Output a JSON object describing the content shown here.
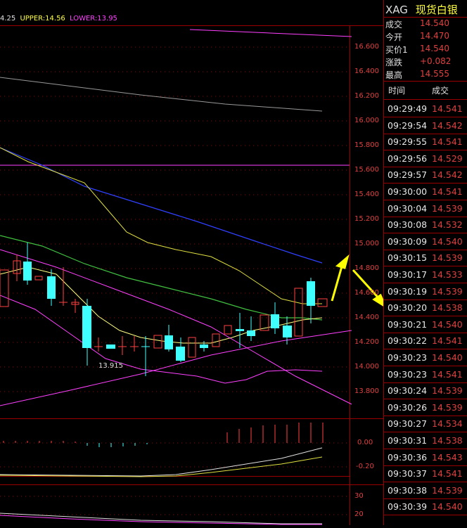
{
  "indicator_legend": {
    "mid": "4.25",
    "upper": "UPPER:14.56",
    "lower": "LOWER:13.95"
  },
  "colors": {
    "up_candle": "#ff4040",
    "down_candle": "#40ffff",
    "grid": "#9a0000",
    "price_text": "#e04040",
    "upper_legend": "#ffff40",
    "lower_legend": "#ff40ff",
    "arrow": "#ffff00"
  },
  "price_axis": [
    "16.600",
    "16.400",
    "16.200",
    "16.000",
    "15.800",
    "15.600",
    "15.400",
    "15.200",
    "15.000",
    "14.800",
    "14.600",
    "14.400",
    "14.200",
    "14.000",
    "13.800"
  ],
  "macd_axis": [
    "0.00",
    "-0.20"
  ],
  "rsi_axis": [
    "30",
    "20"
  ],
  "low_annotation": "13.915",
  "quote": {
    "symbol": "XAG",
    "name": "现货白银",
    "rows": [
      {
        "label": "成交",
        "value": "14.540"
      },
      {
        "label": "今开",
        "value": "14.470"
      },
      {
        "label": "买价1",
        "value": "14.540"
      },
      {
        "label": "涨跌",
        "value": "+0.082"
      },
      {
        "label": "最高",
        "value": "14.555"
      }
    ]
  },
  "trades_header": {
    "time": "时间",
    "price": "成交"
  },
  "trades": [
    {
      "time": "09:29:49",
      "price": "14.541"
    },
    {
      "time": "09:29:54",
      "price": "14.542"
    },
    {
      "time": "09:29:55",
      "price": "14.541"
    },
    {
      "time": "09:29:56",
      "price": "14.529"
    },
    {
      "time": "09:29:57",
      "price": "14.542"
    },
    {
      "time": "09:30:00",
      "price": "14.541"
    },
    {
      "time": "09:30:04",
      "price": "14.539"
    },
    {
      "time": "09:30:08",
      "price": "14.532"
    },
    {
      "time": "09:30:09",
      "price": "14.540"
    },
    {
      "time": "09:30:15",
      "price": "14.539"
    },
    {
      "time": "09:30:17",
      "price": "14.533"
    },
    {
      "time": "09:30:19",
      "price": "14.539"
    },
    {
      "time": "09:30:20",
      "price": "14.538"
    },
    {
      "time": "09:30:21",
      "price": "14.540"
    },
    {
      "time": "09:30:22",
      "price": "14.541"
    },
    {
      "time": "09:30:23",
      "price": "14.540"
    },
    {
      "time": "09:30:23",
      "price": "14.541"
    },
    {
      "time": "09:30:24",
      "price": "14.539"
    },
    {
      "time": "09:30:26",
      "price": "14.539"
    },
    {
      "time": "09:30:27",
      "price": "14.534"
    },
    {
      "time": "09:30:31",
      "price": "14.538"
    },
    {
      "time": "09:30:36",
      "price": "14.543"
    },
    {
      "time": "09:30:37",
      "price": "14.541"
    },
    {
      "time": "09:30:38",
      "price": "14.539"
    },
    {
      "time": "09:30:39",
      "price": "14.540"
    }
  ]
}
